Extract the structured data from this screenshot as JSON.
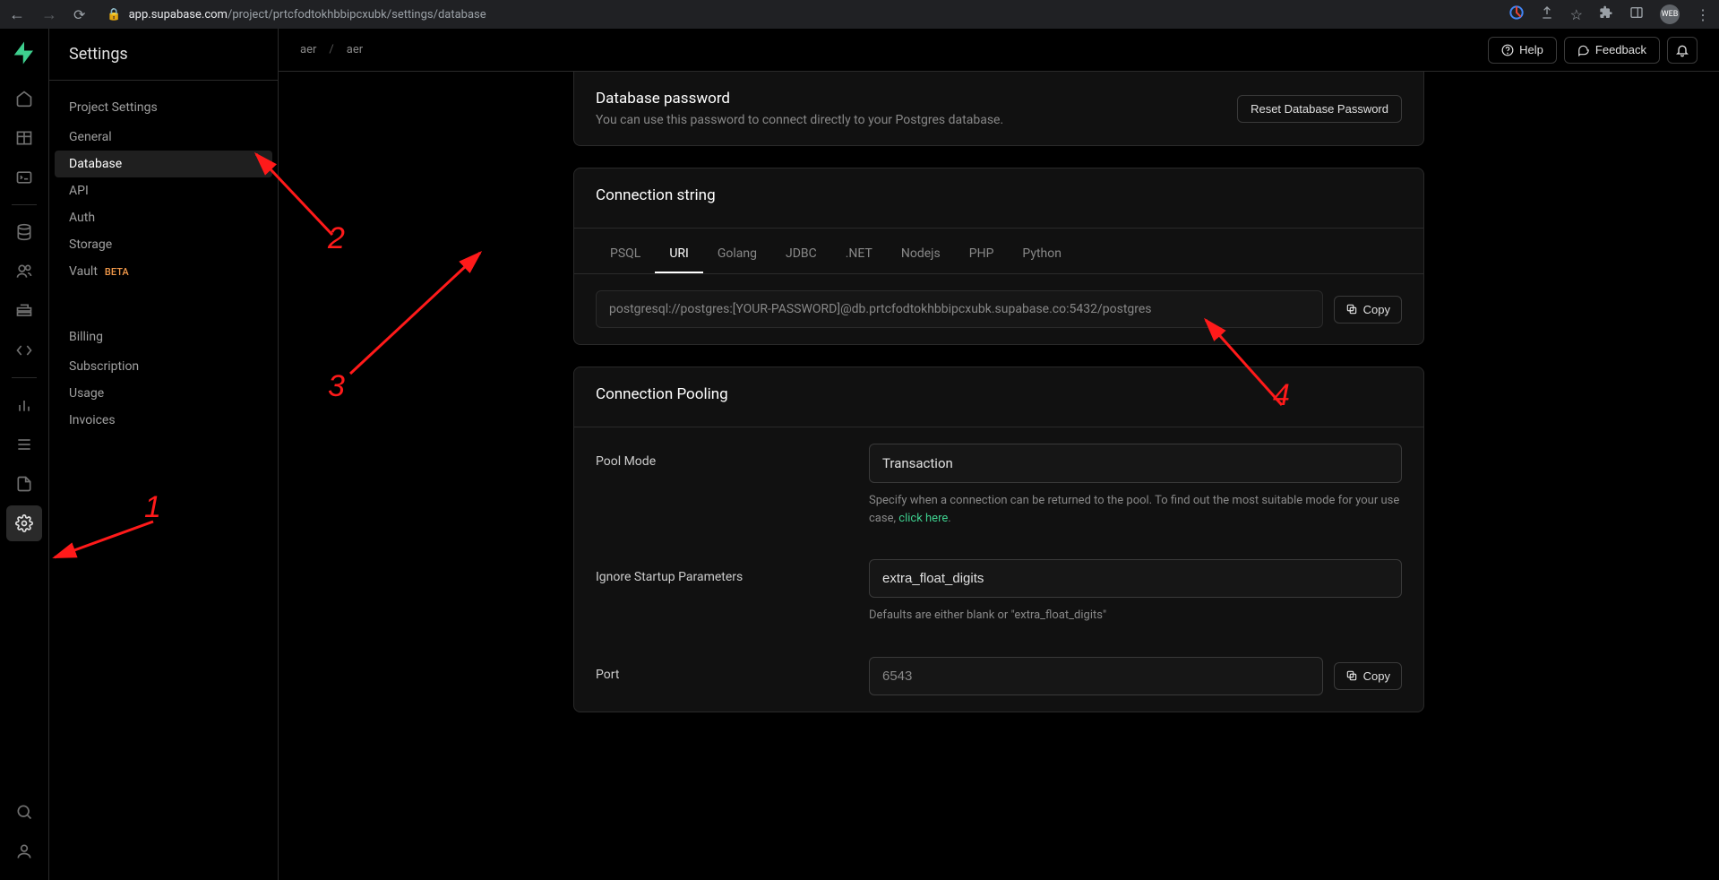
{
  "browser": {
    "url_host": "app.supabase.com",
    "url_path": "/project/prtcfodtokhbbipcxubk/settings/database",
    "avatar_text": "WEB"
  },
  "topbar": {
    "breadcrumb": [
      "aer",
      "aer"
    ],
    "help": "Help",
    "feedback": "Feedback"
  },
  "sidebar": {
    "title": "Settings",
    "section1": "Project Settings",
    "items1": [
      {
        "label": "General"
      },
      {
        "label": "Database",
        "active": true
      },
      {
        "label": "API"
      },
      {
        "label": "Auth"
      },
      {
        "label": "Storage"
      },
      {
        "label": "Vault",
        "badge": "BETA"
      }
    ],
    "section2": "Billing",
    "items2": [
      {
        "label": "Subscription"
      },
      {
        "label": "Usage"
      },
      {
        "label": "Invoices"
      }
    ]
  },
  "cards": {
    "password": {
      "title": "Database password",
      "desc": "You can use this password to connect directly to your Postgres database.",
      "reset_btn": "Reset Database Password"
    },
    "connstr": {
      "title": "Connection string",
      "tabs": [
        "PSQL",
        "URI",
        "Golang",
        "JDBC",
        ".NET",
        "Nodejs",
        "PHP",
        "Python"
      ],
      "active_tab": "URI",
      "value": "postgresql://postgres:[YOUR-PASSWORD]@db.prtcfodtokhbbipcxubk.supabase.co:5432/postgres",
      "copy": "Copy"
    },
    "pooling": {
      "title": "Connection Pooling",
      "pool_mode_label": "Pool Mode",
      "pool_mode_value": "Transaction",
      "pool_mode_help_pre": "Specify when a connection can be returned to the pool. To find out the most suitable mode for your use case, ",
      "pool_mode_help_link": "click here",
      "ignore_label": "Ignore Startup Parameters",
      "ignore_value": "extra_float_digits",
      "ignore_help": "Defaults are either blank or \"extra_float_digits\"",
      "port_label": "Port",
      "port_value": "6543",
      "copy": "Copy"
    }
  },
  "annotations": [
    "1",
    "2",
    "3",
    "4"
  ]
}
